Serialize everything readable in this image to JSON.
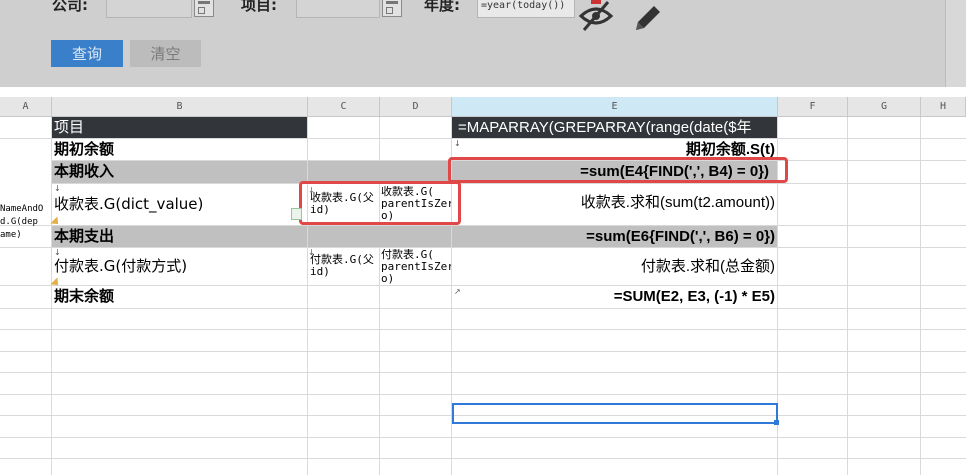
{
  "params": {
    "company_label": "公司:",
    "project_label": "项目:",
    "year_label": "年度:",
    "year_value": "=year(today())",
    "query_label": "查询",
    "clear_label": "清空"
  },
  "columns": [
    "A",
    "B",
    "C",
    "D",
    "E",
    "F",
    "G",
    "H"
  ],
  "cells": {
    "b1": "项目",
    "e1": "=MAPARRAY(GREPARRAY(range(date($年",
    "b2": "期初余额",
    "e2": "期初余额.S(t)",
    "b3": "本期收入",
    "e3": "=sum(E4{FIND(',', B4) = 0})",
    "a4": "NameAndO d.G(dep ame)",
    "b4": "收款表.G(dict_value)",
    "c4": "收款表.G(父 id)",
    "d4": "收款表.G( parentIsZer o)",
    "e4": "收款表.求和(sum(t2.amount))",
    "b5": "本期支出",
    "e5": "=sum(E6{FIND(',', B6) = 0})",
    "b6": "付款表.G(付款方式)",
    "c6": "付款表.G(父 id)",
    "d6": "付款表.G( parentIsZer o)",
    "e6": "付款表.求和(总金额)",
    "b7": "期末余额",
    "e7": "=SUM(E2, E3, (-1) * E5)"
  },
  "colors": {
    "header_dark": "#32363a",
    "highlight_gray": "#c0c0c0",
    "annotation_red": "#e04848",
    "selection_blue": "#2f7ad8",
    "query_blue": "#3a7fc9"
  },
  "icons": [
    "calendar-icon",
    "hide-eye-icon",
    "edit-pencil-icon",
    "document-icon"
  ]
}
